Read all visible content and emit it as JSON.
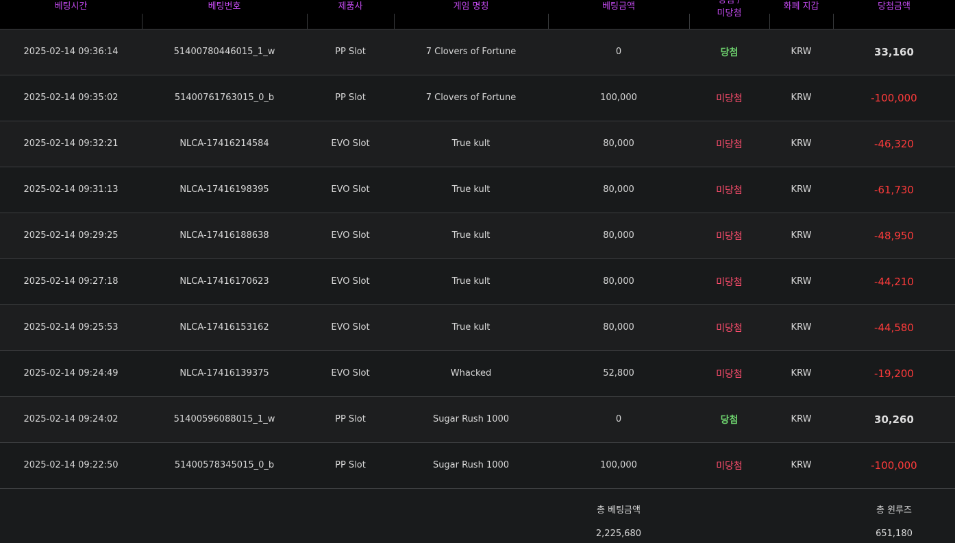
{
  "colors": {
    "header_text": "#c54bf2",
    "header_bg": "#000000",
    "win": "#6ed36e",
    "lose": "#ff4d6d",
    "negative_amount": "#ff3b3b"
  },
  "table": {
    "headers": {
      "bet_time": "베팅시간",
      "bet_number": "베팅번호",
      "provider": "제품사",
      "game_name": "게임 명칭",
      "bet_amount": "베팅금액",
      "result_line1": "당첨 /",
      "result_line2": "미당첨",
      "currency_wallet": "화폐 지갑",
      "win_amount": "당첨금액"
    },
    "rows": [
      {
        "time": "2025-02-14 09:36:14",
        "bet_no": "51400780446015_1_w",
        "provider": "PP Slot",
        "game": "7 Clovers of Fortune",
        "bet": "0",
        "result": "당첨",
        "result_type": "win",
        "currency": "KRW",
        "amount": "33,160"
      },
      {
        "time": "2025-02-14 09:35:02",
        "bet_no": "51400761763015_0_b",
        "provider": "PP Slot",
        "game": "7 Clovers of Fortune",
        "bet": "100,000",
        "result": "미당첨",
        "result_type": "lose",
        "currency": "KRW",
        "amount": "-100,000"
      },
      {
        "time": "2025-02-14 09:32:21",
        "bet_no": "NLCA-17416214584",
        "provider": "EVO Slot",
        "game": "True kult",
        "bet": "80,000",
        "result": "미당첨",
        "result_type": "lose",
        "currency": "KRW",
        "amount": "-46,320"
      },
      {
        "time": "2025-02-14 09:31:13",
        "bet_no": "NLCA-17416198395",
        "provider": "EVO Slot",
        "game": "True kult",
        "bet": "80,000",
        "result": "미당첨",
        "result_type": "lose",
        "currency": "KRW",
        "amount": "-61,730"
      },
      {
        "time": "2025-02-14 09:29:25",
        "bet_no": "NLCA-17416188638",
        "provider": "EVO Slot",
        "game": "True kult",
        "bet": "80,000",
        "result": "미당첨",
        "result_type": "lose",
        "currency": "KRW",
        "amount": "-48,950"
      },
      {
        "time": "2025-02-14 09:27:18",
        "bet_no": "NLCA-17416170623",
        "provider": "EVO Slot",
        "game": "True kult",
        "bet": "80,000",
        "result": "미당첨",
        "result_type": "lose",
        "currency": "KRW",
        "amount": "-44,210"
      },
      {
        "time": "2025-02-14 09:25:53",
        "bet_no": "NLCA-17416153162",
        "provider": "EVO Slot",
        "game": "True kult",
        "bet": "80,000",
        "result": "미당첨",
        "result_type": "lose",
        "currency": "KRW",
        "amount": "-44,580"
      },
      {
        "time": "2025-02-14 09:24:49",
        "bet_no": "NLCA-17416139375",
        "provider": "EVO Slot",
        "game": "Whacked",
        "bet": "52,800",
        "result": "미당첨",
        "result_type": "lose",
        "currency": "KRW",
        "amount": "-19,200"
      },
      {
        "time": "2025-02-14 09:24:02",
        "bet_no": "51400596088015_1_w",
        "provider": "PP Slot",
        "game": "Sugar Rush 1000",
        "bet": "0",
        "result": "당첨",
        "result_type": "win",
        "currency": "KRW",
        "amount": "30,260"
      },
      {
        "time": "2025-02-14 09:22:50",
        "bet_no": "51400578345015_0_b",
        "provider": "PP Slot",
        "game": "Sugar Rush 1000",
        "bet": "100,000",
        "result": "미당첨",
        "result_type": "lose",
        "currency": "KRW",
        "amount": "-100,000"
      }
    ],
    "totals": {
      "bet_label": "총 베팅금액",
      "bet_value": "2,225,680",
      "winloss_label": "총 윈루즈",
      "winloss_value": "651,180"
    }
  }
}
